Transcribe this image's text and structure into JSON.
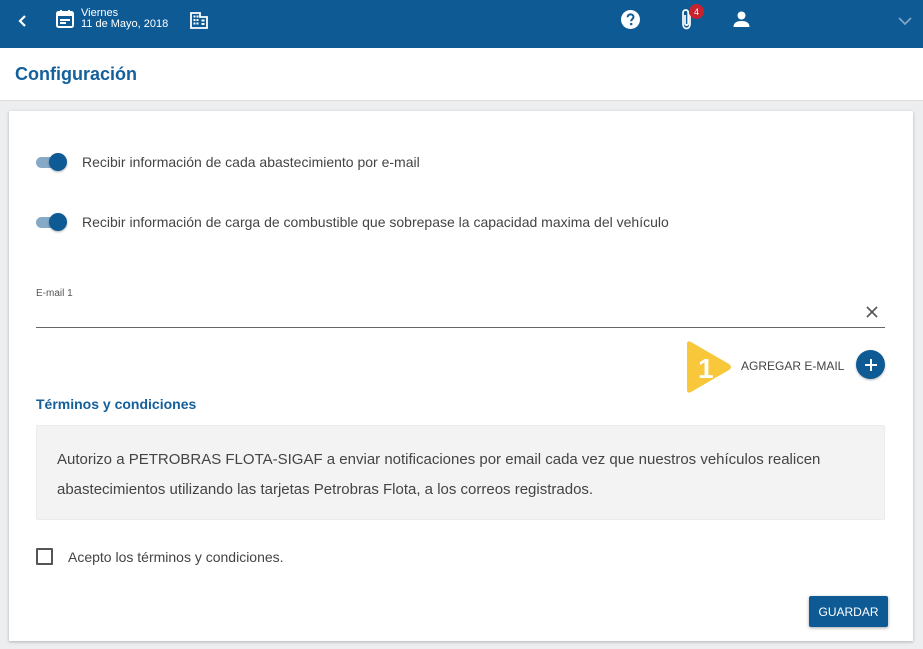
{
  "header": {
    "day_name": "Viernes",
    "date": "11 de Mayo, 2018",
    "notifications_count": "4",
    "icons": [
      "back-icon",
      "calendar-icon",
      "building-icon",
      "help-icon",
      "paperclip-icon",
      "user-icon",
      "chevron-down-icon"
    ]
  },
  "page": {
    "title": "Configuración"
  },
  "settings": {
    "toggles": [
      {
        "label": "Recibir información de cada abastecimiento por e-mail",
        "on": true
      },
      {
        "label": "Recibir información de carga de combustible que sobrepase la capacidad maxima del vehículo",
        "on": true
      }
    ],
    "email_field": {
      "label": "E-mail 1",
      "value": ""
    },
    "add_email_label": "AGREGAR E-MAIL",
    "marker_number": "1"
  },
  "terms": {
    "title": "Términos y condiciones",
    "text": "Autorizo a PETROBRAS FLOTA-SIGAF a enviar notificaciones por email cada vez que nuestros vehículos realicen abastecimientos utilizando las tarjetas Petrobras Flota, a los correos registrados.",
    "accept_label": "Acepto los términos y condiciones.",
    "accepted": false
  },
  "actions": {
    "save_label": "GUARDAR"
  },
  "colors": {
    "primary": "#0e5a95",
    "title": "#14609b",
    "badge": "#c6232f",
    "marker": "#f8c73a"
  }
}
